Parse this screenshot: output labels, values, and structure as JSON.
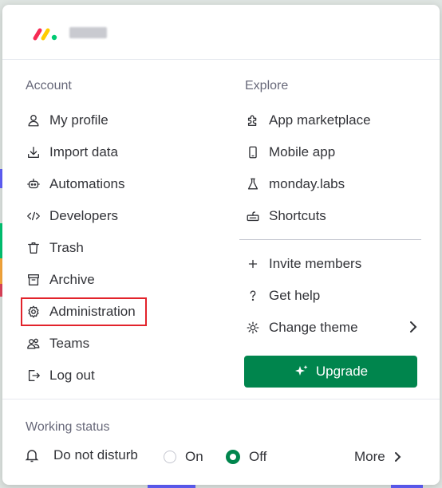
{
  "account": {
    "title": "Account",
    "items": [
      {
        "label": "My profile",
        "icon": "person-icon"
      },
      {
        "label": "Import data",
        "icon": "download-icon"
      },
      {
        "label": "Automations",
        "icon": "robot-icon"
      },
      {
        "label": "Developers",
        "icon": "code-icon"
      },
      {
        "label": "Trash",
        "icon": "trash-icon"
      },
      {
        "label": "Archive",
        "icon": "archive-icon"
      },
      {
        "label": "Administration",
        "icon": "gear-icon"
      },
      {
        "label": "Teams",
        "icon": "team-icon"
      },
      {
        "label": "Log out",
        "icon": "logout-icon"
      }
    ]
  },
  "explore": {
    "title": "Explore",
    "items": [
      {
        "label": "App marketplace",
        "icon": "puzzle-icon"
      },
      {
        "label": "Mobile app",
        "icon": "phone-icon"
      },
      {
        "label": "monday.labs",
        "icon": "flask-icon"
      },
      {
        "label": "Shortcuts",
        "icon": "keyboard-icon"
      }
    ],
    "actions": [
      {
        "label": "Invite members",
        "icon": "plus-icon"
      },
      {
        "label": "Get help",
        "icon": "question-icon"
      },
      {
        "label": "Change theme",
        "icon": "sun-icon"
      }
    ],
    "upgrade_label": "Upgrade"
  },
  "working_status": {
    "title": "Working status",
    "dnd_label": "Do not disturb",
    "on_label": "On",
    "off_label": "Off",
    "selected": "Off",
    "more_label": "More"
  },
  "colors": {
    "accent_green": "#00854d",
    "highlight_red": "#e2232b",
    "logo_red": "#f62b54",
    "logo_yellow": "#ffcc00",
    "logo_green": "#00ca72"
  }
}
